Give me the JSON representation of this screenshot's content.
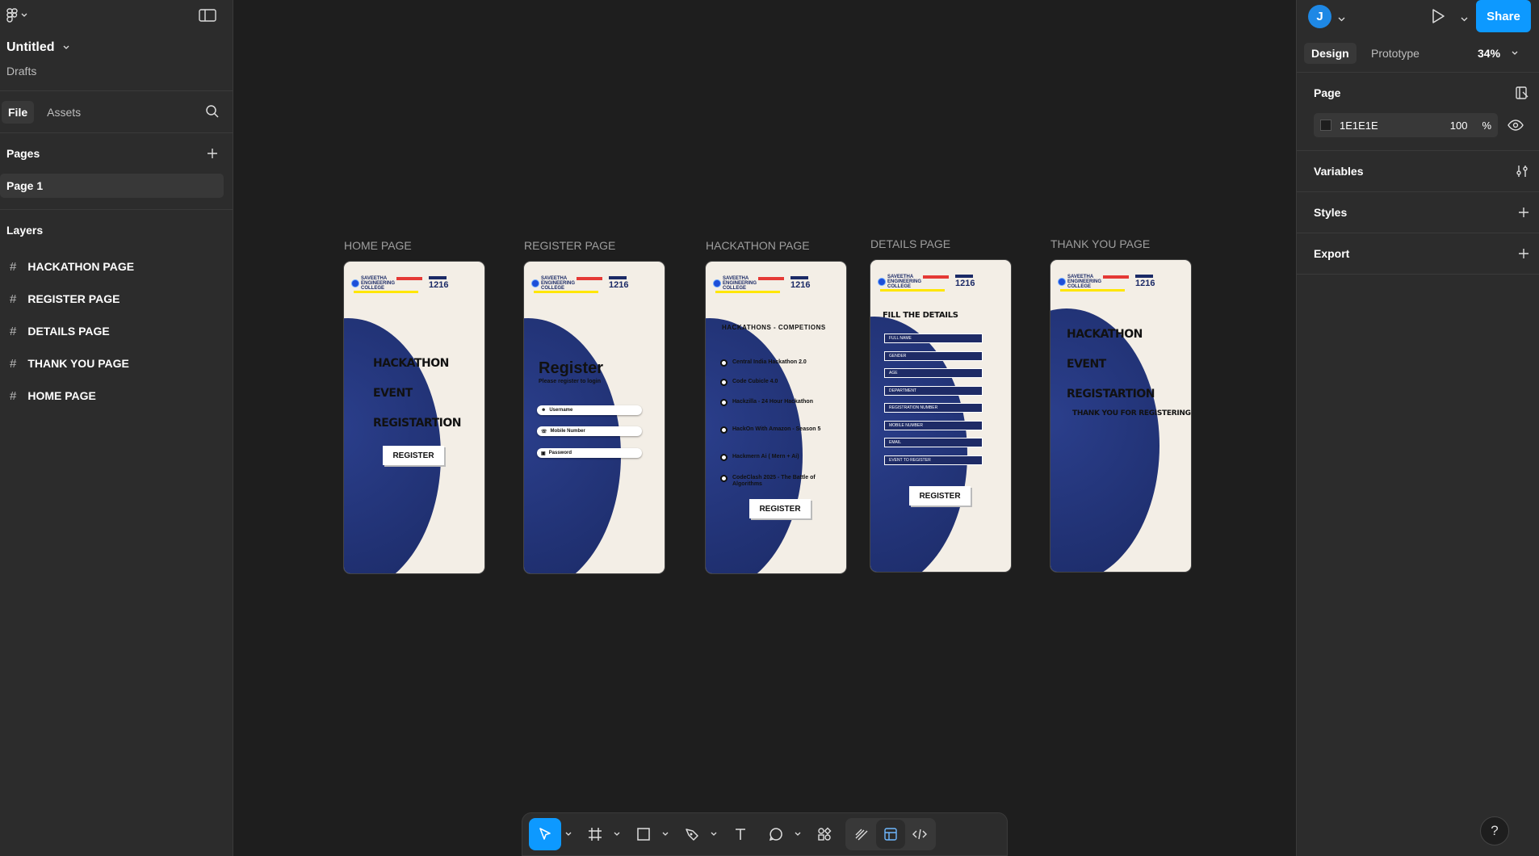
{
  "left_panel": {
    "file_name": "Untitled",
    "location": "Drafts",
    "tabs": [
      {
        "label": "File"
      },
      {
        "label": "Assets"
      }
    ],
    "pages_header": "Pages",
    "pages": [
      {
        "label": "Page 1"
      }
    ],
    "layers_header": "Layers",
    "layers": [
      {
        "label": "HACKATHON PAGE"
      },
      {
        "label": "REGISTER PAGE"
      },
      {
        "label": "DETAILS PAGE"
      },
      {
        "label": "THANK YOU PAGE"
      },
      {
        "label": "HOME PAGE"
      }
    ]
  },
  "right_panel": {
    "avatar_initial": "J",
    "share_label": "Share",
    "tabs": [
      {
        "label": "Design"
      },
      {
        "label": "Prototype"
      }
    ],
    "zoom": "34%",
    "page_section": "Page",
    "page_color": "1E1E1E",
    "page_opacity": "100",
    "percent_sign": "%",
    "variables_section": "Variables",
    "styles_section": "Styles",
    "export_section": "Export",
    "help": "?"
  },
  "canvas": {
    "frames": [
      {
        "label": "HOME PAGE",
        "hero_lines": [
          "HACKATHON",
          "EVENT",
          "REGISTARTION"
        ],
        "button": "REGISTER"
      },
      {
        "label": "REGISTER PAGE",
        "title": "Register",
        "subtitle": "Please register to login",
        "fields": [
          "Username",
          "Mobile Number",
          "Password"
        ]
      },
      {
        "label": "HACKATHON PAGE",
        "title": "HACKATHONS - COMPETIONS",
        "items": [
          "Central India Hackathon 2.0",
          "Code Cubicle 4.0",
          "Hackzilla - 24 Hour Hackathon",
          "HackOn With Amazon - Season 5",
          "Hackmern Ai ( Mern + Ai)",
          "CodeClash 2025 - The Battle of Algorithms"
        ],
        "button": "REGISTER"
      },
      {
        "label": "DETAILS PAGE",
        "title": "FILL THE DETAILS",
        "fields": [
          "FULL NAME",
          "GENDER",
          "AGE",
          "DEPARTMENT",
          "REGISTRATION NUMBER",
          "MOBILE NUMBER",
          "EMAIL",
          "EVENT TO REGISTER"
        ],
        "button": "REGISTER"
      },
      {
        "label": "THANK YOU PAGE",
        "hero_lines": [
          "HACKATHON",
          "EVENT",
          "REGISTARTION"
        ],
        "subtitle": "THANK YOU FOR REGISTERING"
      }
    ],
    "logo": {
      "college": "SAVEETHA ENGINEERING COLLEGE",
      "code": "1216"
    }
  },
  "toolbar": {
    "tools": [
      "move-tool",
      "frame-tool",
      "rectangle-tool",
      "pen-tool",
      "text-tool",
      "comment-tool",
      "actions-tool",
      "draw-mode",
      "design-mode",
      "dev-mode"
    ]
  },
  "colors": {
    "canvas_bg": "#1e1e1e",
    "panel_bg": "#2c2c2c",
    "accent": "#0d99ff",
    "frame_bg": "#f3eee6",
    "frame_blob": "#1b2a66"
  }
}
